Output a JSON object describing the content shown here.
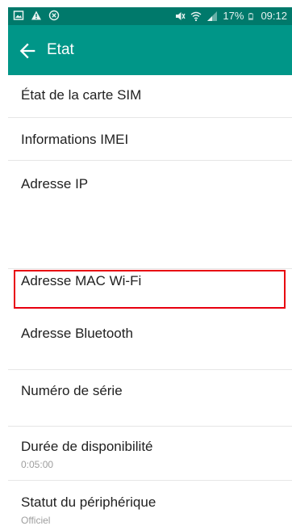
{
  "status_bar": {
    "battery": "17%",
    "time": "09:12",
    "icons": [
      "image-icon",
      "warning-icon",
      "circle-x-icon",
      "mute-icon",
      "wifi-icon",
      "signal-icon",
      "battery-icon"
    ]
  },
  "app_bar": {
    "title": "Etat",
    "back_icon": "back-arrow-icon"
  },
  "items": [
    {
      "label": "État de la carte SIM",
      "sub": ""
    },
    {
      "label": "Informations IMEI",
      "sub": ""
    },
    {
      "label": "Adresse IP",
      "sub": ""
    },
    {
      "label": "Adresse MAC Wi-Fi",
      "sub": ""
    },
    {
      "label": "Adresse Bluetooth",
      "sub": ""
    },
    {
      "label": "Numéro de série",
      "sub": ""
    },
    {
      "label": "Durée de disponibilité",
      "sub": "0:05:00"
    },
    {
      "label": "Statut du périphérique",
      "sub": "Officiel"
    }
  ],
  "colors": {
    "status_bar": "#00796b",
    "app_bar": "#009688",
    "highlight": "#e8000f"
  }
}
